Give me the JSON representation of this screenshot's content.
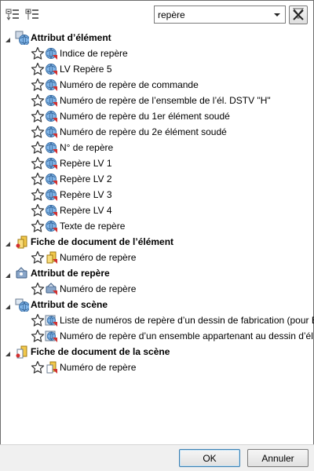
{
  "toolbar": {
    "collapse_all_icon": "collapse-all-icon",
    "expand_all_icon": "expand-all-icon"
  },
  "search": {
    "value": "repère",
    "dropdown_icon": "chevron-down-icon",
    "clear_icon": "clear-filter-icon"
  },
  "tree": {
    "groups": [
      {
        "label": "Attribut d’élément",
        "icon": "element-attribute-icon",
        "expanded": true,
        "items": [
          "Indice de repère",
          "LV Repère 5",
          "Numéro de repère de commande",
          "Numéro de repère de l’ensemble de l’él. DSTV \"H\"",
          "Numéro de repère du 1er élément soudé",
          "Numéro de repère du 2e élément soudé",
          "N° de repère",
          "Repère LV 1",
          "Repère LV 2",
          "Repère LV 3",
          "Repère LV 4",
          "Texte de repère"
        ]
      },
      {
        "label": "Fiche de document de l’élément",
        "icon": "element-document-sheet-icon",
        "expanded": true,
        "items": [
          "Numéro de repère"
        ]
      },
      {
        "label": "Attribut de repère",
        "icon": "itemnumber-attribute-icon",
        "expanded": true,
        "items": [
          "Numéro de repère"
        ]
      },
      {
        "label": "Attribut de scène",
        "icon": "scene-attribute-icon",
        "expanded": true,
        "items": [
          "Liste de numéros de repère d’un dessin de fabrication (pour B",
          "Numéro de repère d’un ensemble appartenant au dessin d’él"
        ]
      },
      {
        "label": "Fiche de document de la scène",
        "icon": "scene-document-sheet-icon",
        "expanded": true,
        "items": [
          "Numéro de repère"
        ]
      }
    ]
  },
  "footer": {
    "ok_label": "OK",
    "cancel_label": "Annuler"
  },
  "colors": {
    "accent_border": "#3c7fb1",
    "group_triangle": "#404040",
    "footer_bg": "#f0f0f0"
  }
}
